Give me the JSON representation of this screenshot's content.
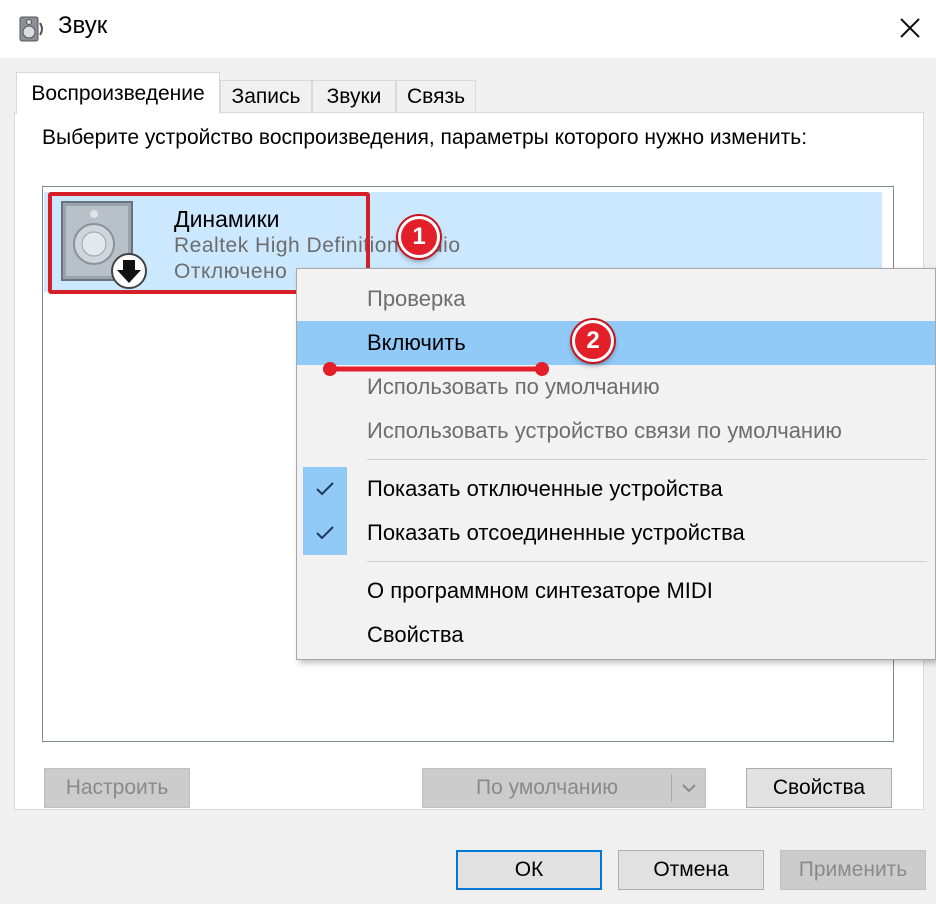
{
  "window": {
    "title": "Звук",
    "icon": "speaker-icon",
    "close_icon": "close-icon"
  },
  "tabs": [
    {
      "label": "Воспроизведение",
      "active": true
    },
    {
      "label": "Запись",
      "active": false
    },
    {
      "label": "Звуки",
      "active": false
    },
    {
      "label": "Связь",
      "active": false
    }
  ],
  "playback": {
    "instruction": "Выберите устройство воспроизведения, параметры которого нужно изменить:",
    "device": {
      "name": "Динамики",
      "driver": "Realtek High Definition Audio",
      "status": "Отключено",
      "icon": "speaker-device-icon",
      "status_icon": "disabled-arrow-icon"
    }
  },
  "context_menu": {
    "items": [
      {
        "label": "Проверка",
        "enabled": false
      },
      {
        "label": "Включить",
        "enabled": true,
        "highlighted": true
      },
      {
        "label": "Использовать по умолчанию",
        "enabled": false
      },
      {
        "label": "Использовать устройство связи по умолчанию",
        "enabled": false
      },
      {
        "label": "Показать отключенные устройства",
        "enabled": true,
        "checked": true
      },
      {
        "label": "Показать отсоединенные устройства",
        "enabled": true,
        "checked": true
      },
      {
        "label": "О программном синтезаторе MIDI",
        "enabled": true
      },
      {
        "label": "Свойства",
        "enabled": true
      }
    ]
  },
  "annotations": {
    "badge_1": "1",
    "badge_2": "2",
    "highlight_color": "#d71f2a"
  },
  "buttons": {
    "configure": "Настроить",
    "default": "По умолчанию",
    "properties": "Свойства",
    "ok": "ОК",
    "cancel": "Отмена",
    "apply": "Применить"
  },
  "colors": {
    "accent": "#0078d7",
    "selection": "#cce8ff",
    "menu_highlight": "#91c9f7",
    "badge": "#e3202a"
  }
}
